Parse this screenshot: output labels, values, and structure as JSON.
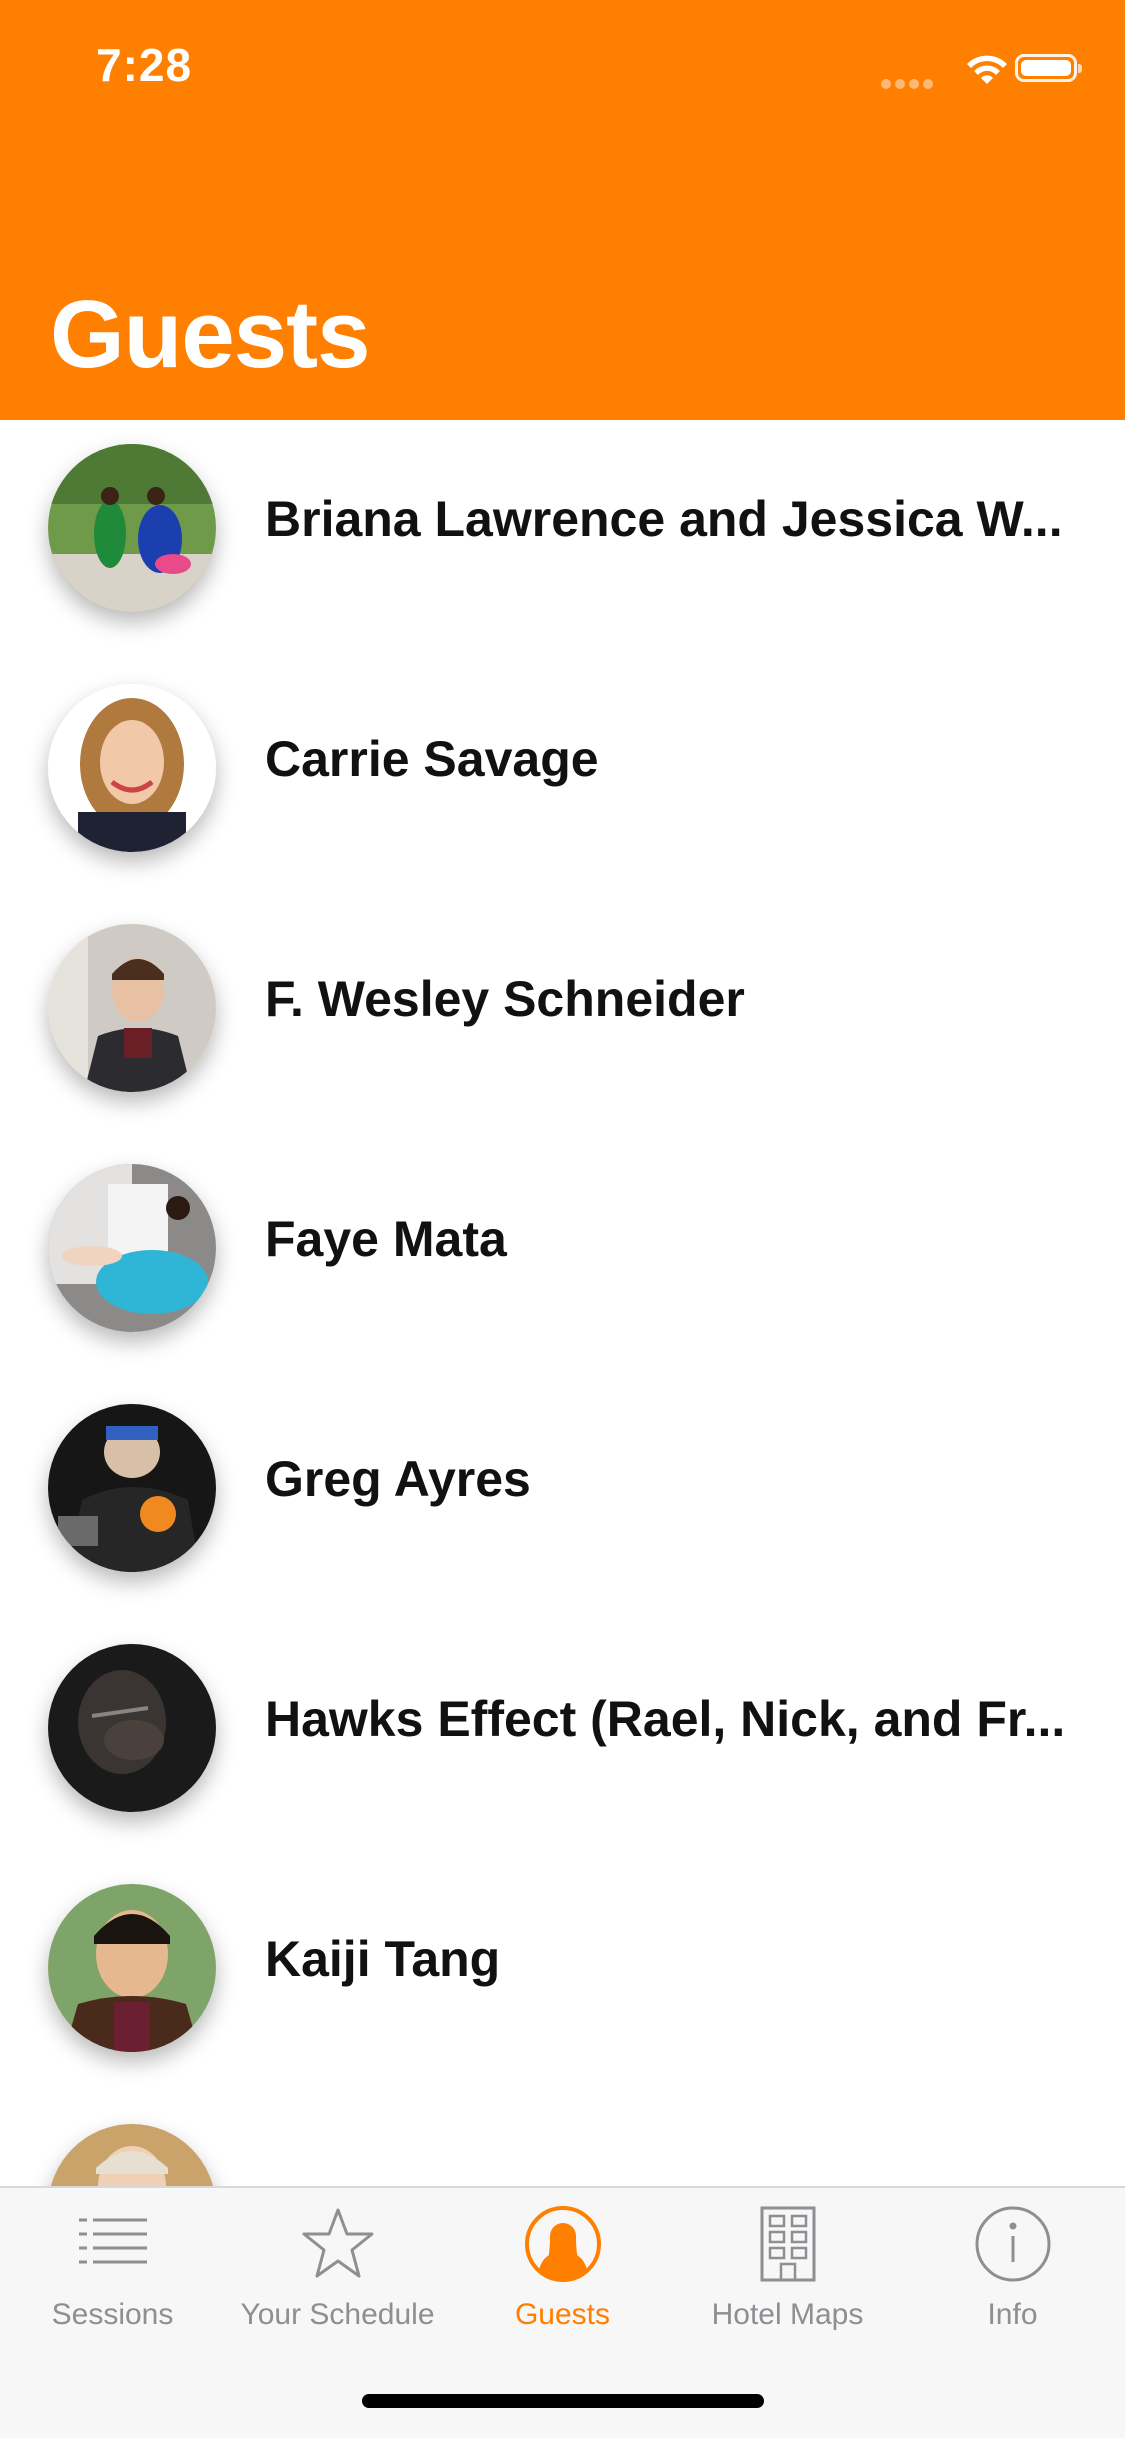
{
  "status_bar": {
    "time": "7:28"
  },
  "header": {
    "title": "Guests",
    "color": "#FF7F00"
  },
  "guests": [
    {
      "name": "Briana Lawrence and Jessica W..."
    },
    {
      "name": "Carrie Savage"
    },
    {
      "name": "F. Wesley Schneider"
    },
    {
      "name": "Faye Mata"
    },
    {
      "name": "Greg Ayres"
    },
    {
      "name": "Hawks Effect (Rael, Nick, and Fr..."
    },
    {
      "name": "Kaiji Tang"
    },
    {
      "name": ""
    }
  ],
  "tab_bar": {
    "active": "Guests",
    "active_color": "#FF7F00",
    "tabs": [
      {
        "label": "Sessions",
        "icon": "list-icon"
      },
      {
        "label": "Your Schedule",
        "icon": "star-icon"
      },
      {
        "label": "Guests",
        "icon": "person-icon"
      },
      {
        "label": "Hotel Maps",
        "icon": "building-icon"
      },
      {
        "label": "Info",
        "icon": "info-icon"
      }
    ]
  }
}
